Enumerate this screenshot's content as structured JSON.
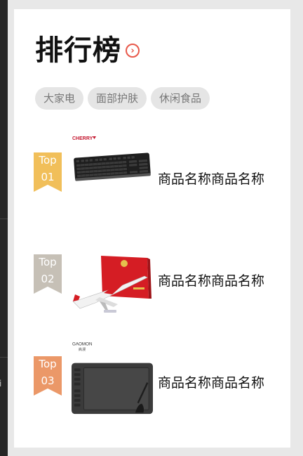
{
  "page": {
    "title": "排行榜",
    "more_icon": "chevron-right-circle-icon",
    "accent_color": "#e8584a"
  },
  "categories": [
    "大家电",
    "面部护肤",
    "休闲食品"
  ],
  "ranking": [
    {
      "rank_label": "Top",
      "rank_number": "01",
      "brand": "CHERRY",
      "image": "keyboard",
      "name": "商品名称商品名称",
      "ribbon_color": "#f1bf5a"
    },
    {
      "rank_label": "Top",
      "rank_number": "02",
      "brand": "",
      "image": "airplane-model",
      "name": "商品名称商品名称",
      "ribbon_color": "#c6c0b6"
    },
    {
      "rank_label": "Top",
      "rank_number": "03",
      "brand": "GAOMON 高漫",
      "image": "drawing-tablet",
      "name": "商品名称商品名称",
      "ribbon_color": "#eb9868"
    }
  ],
  "left_panel": {
    "stub_text": "i"
  }
}
